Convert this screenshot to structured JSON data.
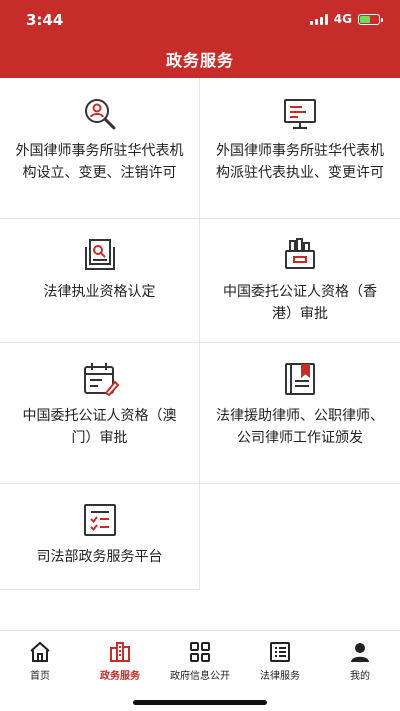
{
  "status_bar": {
    "time": "3:44",
    "network": "4G"
  },
  "header": {
    "title": "政务服务"
  },
  "services": [
    {
      "label": "外国律师事务所驻华代表机构设立、变更、注销许可",
      "icon": "search-person-icon"
    },
    {
      "label": "外国律师事务所驻华代表机构派驻代表执业、变更许可",
      "icon": "monitor-icon"
    },
    {
      "label": "法律执业资格认定",
      "icon": "document-search-icon"
    },
    {
      "label": "中国委托公证人资格（香港）审批",
      "icon": "stamp-machine-icon"
    },
    {
      "label": "中国委托公证人资格（澳门）审批",
      "icon": "calendar-edit-icon"
    },
    {
      "label": "法律援助律师、公职律师、公司律师工作证颁发",
      "icon": "book-bookmark-icon"
    },
    {
      "label": "司法部政务服务平台",
      "icon": "checklist-icon"
    }
  ],
  "tabbar": {
    "items": [
      {
        "label": "首页",
        "icon": "home-icon"
      },
      {
        "label": "政务服务",
        "icon": "building-icon"
      },
      {
        "label": "政府信息公开",
        "icon": "grid-icon"
      },
      {
        "label": "法律服务",
        "icon": "list-icon"
      },
      {
        "label": "我的",
        "icon": "user-icon"
      }
    ],
    "active": "政务服务"
  },
  "colors": {
    "brand": "#c62d2a",
    "icon": "#333333",
    "accent": "#c62d2a"
  }
}
